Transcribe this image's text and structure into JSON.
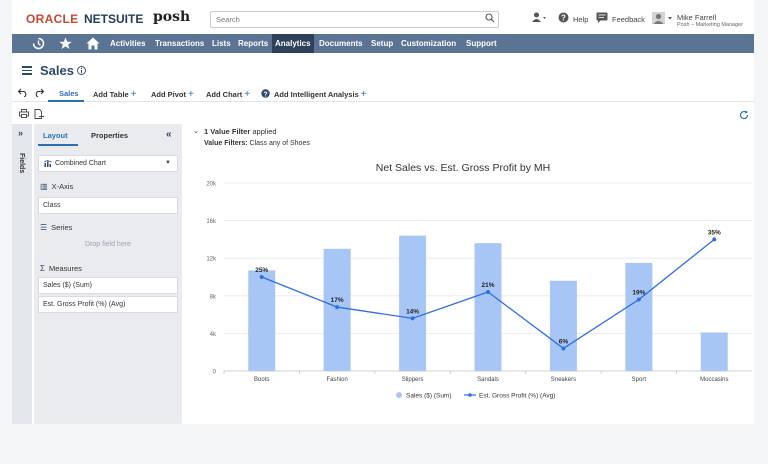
{
  "brand": {
    "oracle": "ORACLE",
    "netsuite": "NETSUITE",
    "account": "posh"
  },
  "search": {
    "placeholder": "Search"
  },
  "top_actions": {
    "help": "Help",
    "feedback": "Feedback"
  },
  "user": {
    "name": "Mike Farrell",
    "role": "Posh – Marketing Manager"
  },
  "nav": {
    "items": [
      "Activities",
      "Transactions",
      "Lists",
      "Reports",
      "Analytics",
      "Documents",
      "Setup",
      "Customization",
      "Support"
    ],
    "active": "Analytics"
  },
  "page": {
    "title": "Sales"
  },
  "tabs": {
    "sales": "Sales",
    "add_table": "Add Table",
    "add_pivot": "Add Pivot",
    "add_chart": "Add Chart",
    "add_intelligent": "Add Intelligent Analysis"
  },
  "panel": {
    "strip_label": "Fields",
    "layout_tab": "Layout",
    "properties_tab": "Properties",
    "chart_type": "Combined Chart",
    "xaxis_label": "X-Axis",
    "xaxis_value": "Class",
    "series_label": "Series",
    "series_drop": "Drop field here",
    "measures_label": "Measures",
    "measures": [
      "Sales ($) (Sum)",
      "Est. Gross Profit (%) (Avg)"
    ]
  },
  "filter": {
    "summary_bold": "1 Value Filter",
    "summary_rest": " applied",
    "detail_bold": "Value Filters:",
    "detail_rest": " Class any of Shoes"
  },
  "colors": {
    "bar": "#a8c6f5",
    "line": "#2f6fe0",
    "nav_bg": "#5b7494",
    "accent": "#2d6fb5"
  },
  "chart_data": {
    "type": "bar",
    "title": "Net Sales vs. Est. Gross Profit by MH",
    "categories": [
      "Boots",
      "Fashion",
      "Slippers",
      "Sandals",
      "Sneakers",
      "Sport",
      "Moccasins"
    ],
    "y_ticks": [
      "0",
      "4k",
      "8k",
      "12k",
      "16k",
      "20k"
    ],
    "ylim": [
      0,
      20000
    ],
    "series": [
      {
        "name": "Sales ($) (Sum)",
        "type": "bar",
        "values": [
          10700,
          13000,
          14400,
          13600,
          9600,
          11500,
          4100
        ]
      },
      {
        "name": "Est. Gross Profit (%) (Avg)",
        "type": "line",
        "values": [
          25,
          17,
          14,
          21,
          6,
          19,
          35
        ],
        "labels": [
          "25%",
          "17%",
          "14%",
          "21%",
          "6%",
          "19%",
          "35%"
        ],
        "ylim": [
          0,
          50
        ]
      }
    ],
    "legend": "bottom",
    "grid": true
  }
}
